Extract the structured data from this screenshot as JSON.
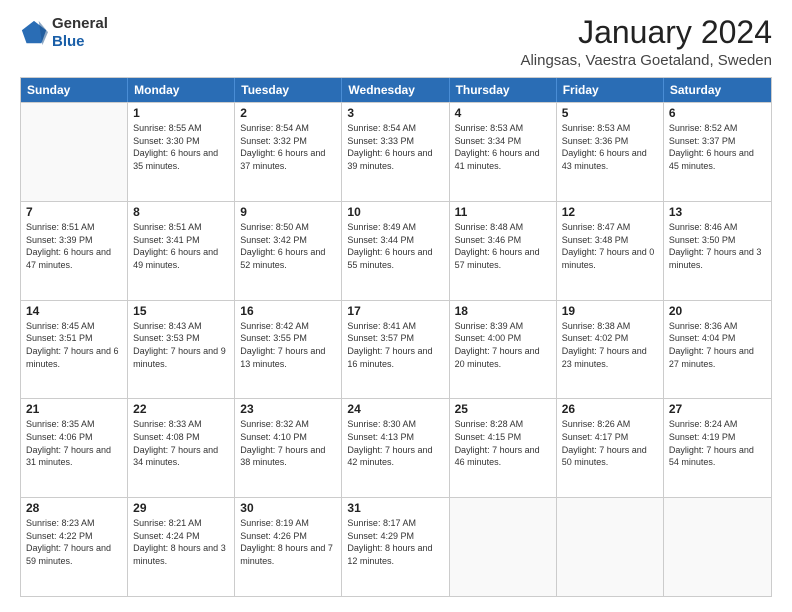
{
  "header": {
    "logo_general": "General",
    "logo_blue": "Blue",
    "month_title": "January 2024",
    "location": "Alingsas, Vaestra Goetaland, Sweden"
  },
  "days": [
    "Sunday",
    "Monday",
    "Tuesday",
    "Wednesday",
    "Thursday",
    "Friday",
    "Saturday"
  ],
  "weeks": [
    [
      {
        "date": "",
        "sunrise": "",
        "sunset": "",
        "daylight": ""
      },
      {
        "date": "1",
        "sunrise": "Sunrise: 8:55 AM",
        "sunset": "Sunset: 3:30 PM",
        "daylight": "Daylight: 6 hours and 35 minutes."
      },
      {
        "date": "2",
        "sunrise": "Sunrise: 8:54 AM",
        "sunset": "Sunset: 3:32 PM",
        "daylight": "Daylight: 6 hours and 37 minutes."
      },
      {
        "date": "3",
        "sunrise": "Sunrise: 8:54 AM",
        "sunset": "Sunset: 3:33 PM",
        "daylight": "Daylight: 6 hours and 39 minutes."
      },
      {
        "date": "4",
        "sunrise": "Sunrise: 8:53 AM",
        "sunset": "Sunset: 3:34 PM",
        "daylight": "Daylight: 6 hours and 41 minutes."
      },
      {
        "date": "5",
        "sunrise": "Sunrise: 8:53 AM",
        "sunset": "Sunset: 3:36 PM",
        "daylight": "Daylight: 6 hours and 43 minutes."
      },
      {
        "date": "6",
        "sunrise": "Sunrise: 8:52 AM",
        "sunset": "Sunset: 3:37 PM",
        "daylight": "Daylight: 6 hours and 45 minutes."
      }
    ],
    [
      {
        "date": "7",
        "sunrise": "Sunrise: 8:51 AM",
        "sunset": "Sunset: 3:39 PM",
        "daylight": "Daylight: 6 hours and 47 minutes."
      },
      {
        "date": "8",
        "sunrise": "Sunrise: 8:51 AM",
        "sunset": "Sunset: 3:41 PM",
        "daylight": "Daylight: 6 hours and 49 minutes."
      },
      {
        "date": "9",
        "sunrise": "Sunrise: 8:50 AM",
        "sunset": "Sunset: 3:42 PM",
        "daylight": "Daylight: 6 hours and 52 minutes."
      },
      {
        "date": "10",
        "sunrise": "Sunrise: 8:49 AM",
        "sunset": "Sunset: 3:44 PM",
        "daylight": "Daylight: 6 hours and 55 minutes."
      },
      {
        "date": "11",
        "sunrise": "Sunrise: 8:48 AM",
        "sunset": "Sunset: 3:46 PM",
        "daylight": "Daylight: 6 hours and 57 minutes."
      },
      {
        "date": "12",
        "sunrise": "Sunrise: 8:47 AM",
        "sunset": "Sunset: 3:48 PM",
        "daylight": "Daylight: 7 hours and 0 minutes."
      },
      {
        "date": "13",
        "sunrise": "Sunrise: 8:46 AM",
        "sunset": "Sunset: 3:50 PM",
        "daylight": "Daylight: 7 hours and 3 minutes."
      }
    ],
    [
      {
        "date": "14",
        "sunrise": "Sunrise: 8:45 AM",
        "sunset": "Sunset: 3:51 PM",
        "daylight": "Daylight: 7 hours and 6 minutes."
      },
      {
        "date": "15",
        "sunrise": "Sunrise: 8:43 AM",
        "sunset": "Sunset: 3:53 PM",
        "daylight": "Daylight: 7 hours and 9 minutes."
      },
      {
        "date": "16",
        "sunrise": "Sunrise: 8:42 AM",
        "sunset": "Sunset: 3:55 PM",
        "daylight": "Daylight: 7 hours and 13 minutes."
      },
      {
        "date": "17",
        "sunrise": "Sunrise: 8:41 AM",
        "sunset": "Sunset: 3:57 PM",
        "daylight": "Daylight: 7 hours and 16 minutes."
      },
      {
        "date": "18",
        "sunrise": "Sunrise: 8:39 AM",
        "sunset": "Sunset: 4:00 PM",
        "daylight": "Daylight: 7 hours and 20 minutes."
      },
      {
        "date": "19",
        "sunrise": "Sunrise: 8:38 AM",
        "sunset": "Sunset: 4:02 PM",
        "daylight": "Daylight: 7 hours and 23 minutes."
      },
      {
        "date": "20",
        "sunrise": "Sunrise: 8:36 AM",
        "sunset": "Sunset: 4:04 PM",
        "daylight": "Daylight: 7 hours and 27 minutes."
      }
    ],
    [
      {
        "date": "21",
        "sunrise": "Sunrise: 8:35 AM",
        "sunset": "Sunset: 4:06 PM",
        "daylight": "Daylight: 7 hours and 31 minutes."
      },
      {
        "date": "22",
        "sunrise": "Sunrise: 8:33 AM",
        "sunset": "Sunset: 4:08 PM",
        "daylight": "Daylight: 7 hours and 34 minutes."
      },
      {
        "date": "23",
        "sunrise": "Sunrise: 8:32 AM",
        "sunset": "Sunset: 4:10 PM",
        "daylight": "Daylight: 7 hours and 38 minutes."
      },
      {
        "date": "24",
        "sunrise": "Sunrise: 8:30 AM",
        "sunset": "Sunset: 4:13 PM",
        "daylight": "Daylight: 7 hours and 42 minutes."
      },
      {
        "date": "25",
        "sunrise": "Sunrise: 8:28 AM",
        "sunset": "Sunset: 4:15 PM",
        "daylight": "Daylight: 7 hours and 46 minutes."
      },
      {
        "date": "26",
        "sunrise": "Sunrise: 8:26 AM",
        "sunset": "Sunset: 4:17 PM",
        "daylight": "Daylight: 7 hours and 50 minutes."
      },
      {
        "date": "27",
        "sunrise": "Sunrise: 8:24 AM",
        "sunset": "Sunset: 4:19 PM",
        "daylight": "Daylight: 7 hours and 54 minutes."
      }
    ],
    [
      {
        "date": "28",
        "sunrise": "Sunrise: 8:23 AM",
        "sunset": "Sunset: 4:22 PM",
        "daylight": "Daylight: 7 hours and 59 minutes."
      },
      {
        "date": "29",
        "sunrise": "Sunrise: 8:21 AM",
        "sunset": "Sunset: 4:24 PM",
        "daylight": "Daylight: 8 hours and 3 minutes."
      },
      {
        "date": "30",
        "sunrise": "Sunrise: 8:19 AM",
        "sunset": "Sunset: 4:26 PM",
        "daylight": "Daylight: 8 hours and 7 minutes."
      },
      {
        "date": "31",
        "sunrise": "Sunrise: 8:17 AM",
        "sunset": "Sunset: 4:29 PM",
        "daylight": "Daylight: 8 hours and 12 minutes."
      },
      {
        "date": "",
        "sunrise": "",
        "sunset": "",
        "daylight": ""
      },
      {
        "date": "",
        "sunrise": "",
        "sunset": "",
        "daylight": ""
      },
      {
        "date": "",
        "sunrise": "",
        "sunset": "",
        "daylight": ""
      }
    ]
  ]
}
